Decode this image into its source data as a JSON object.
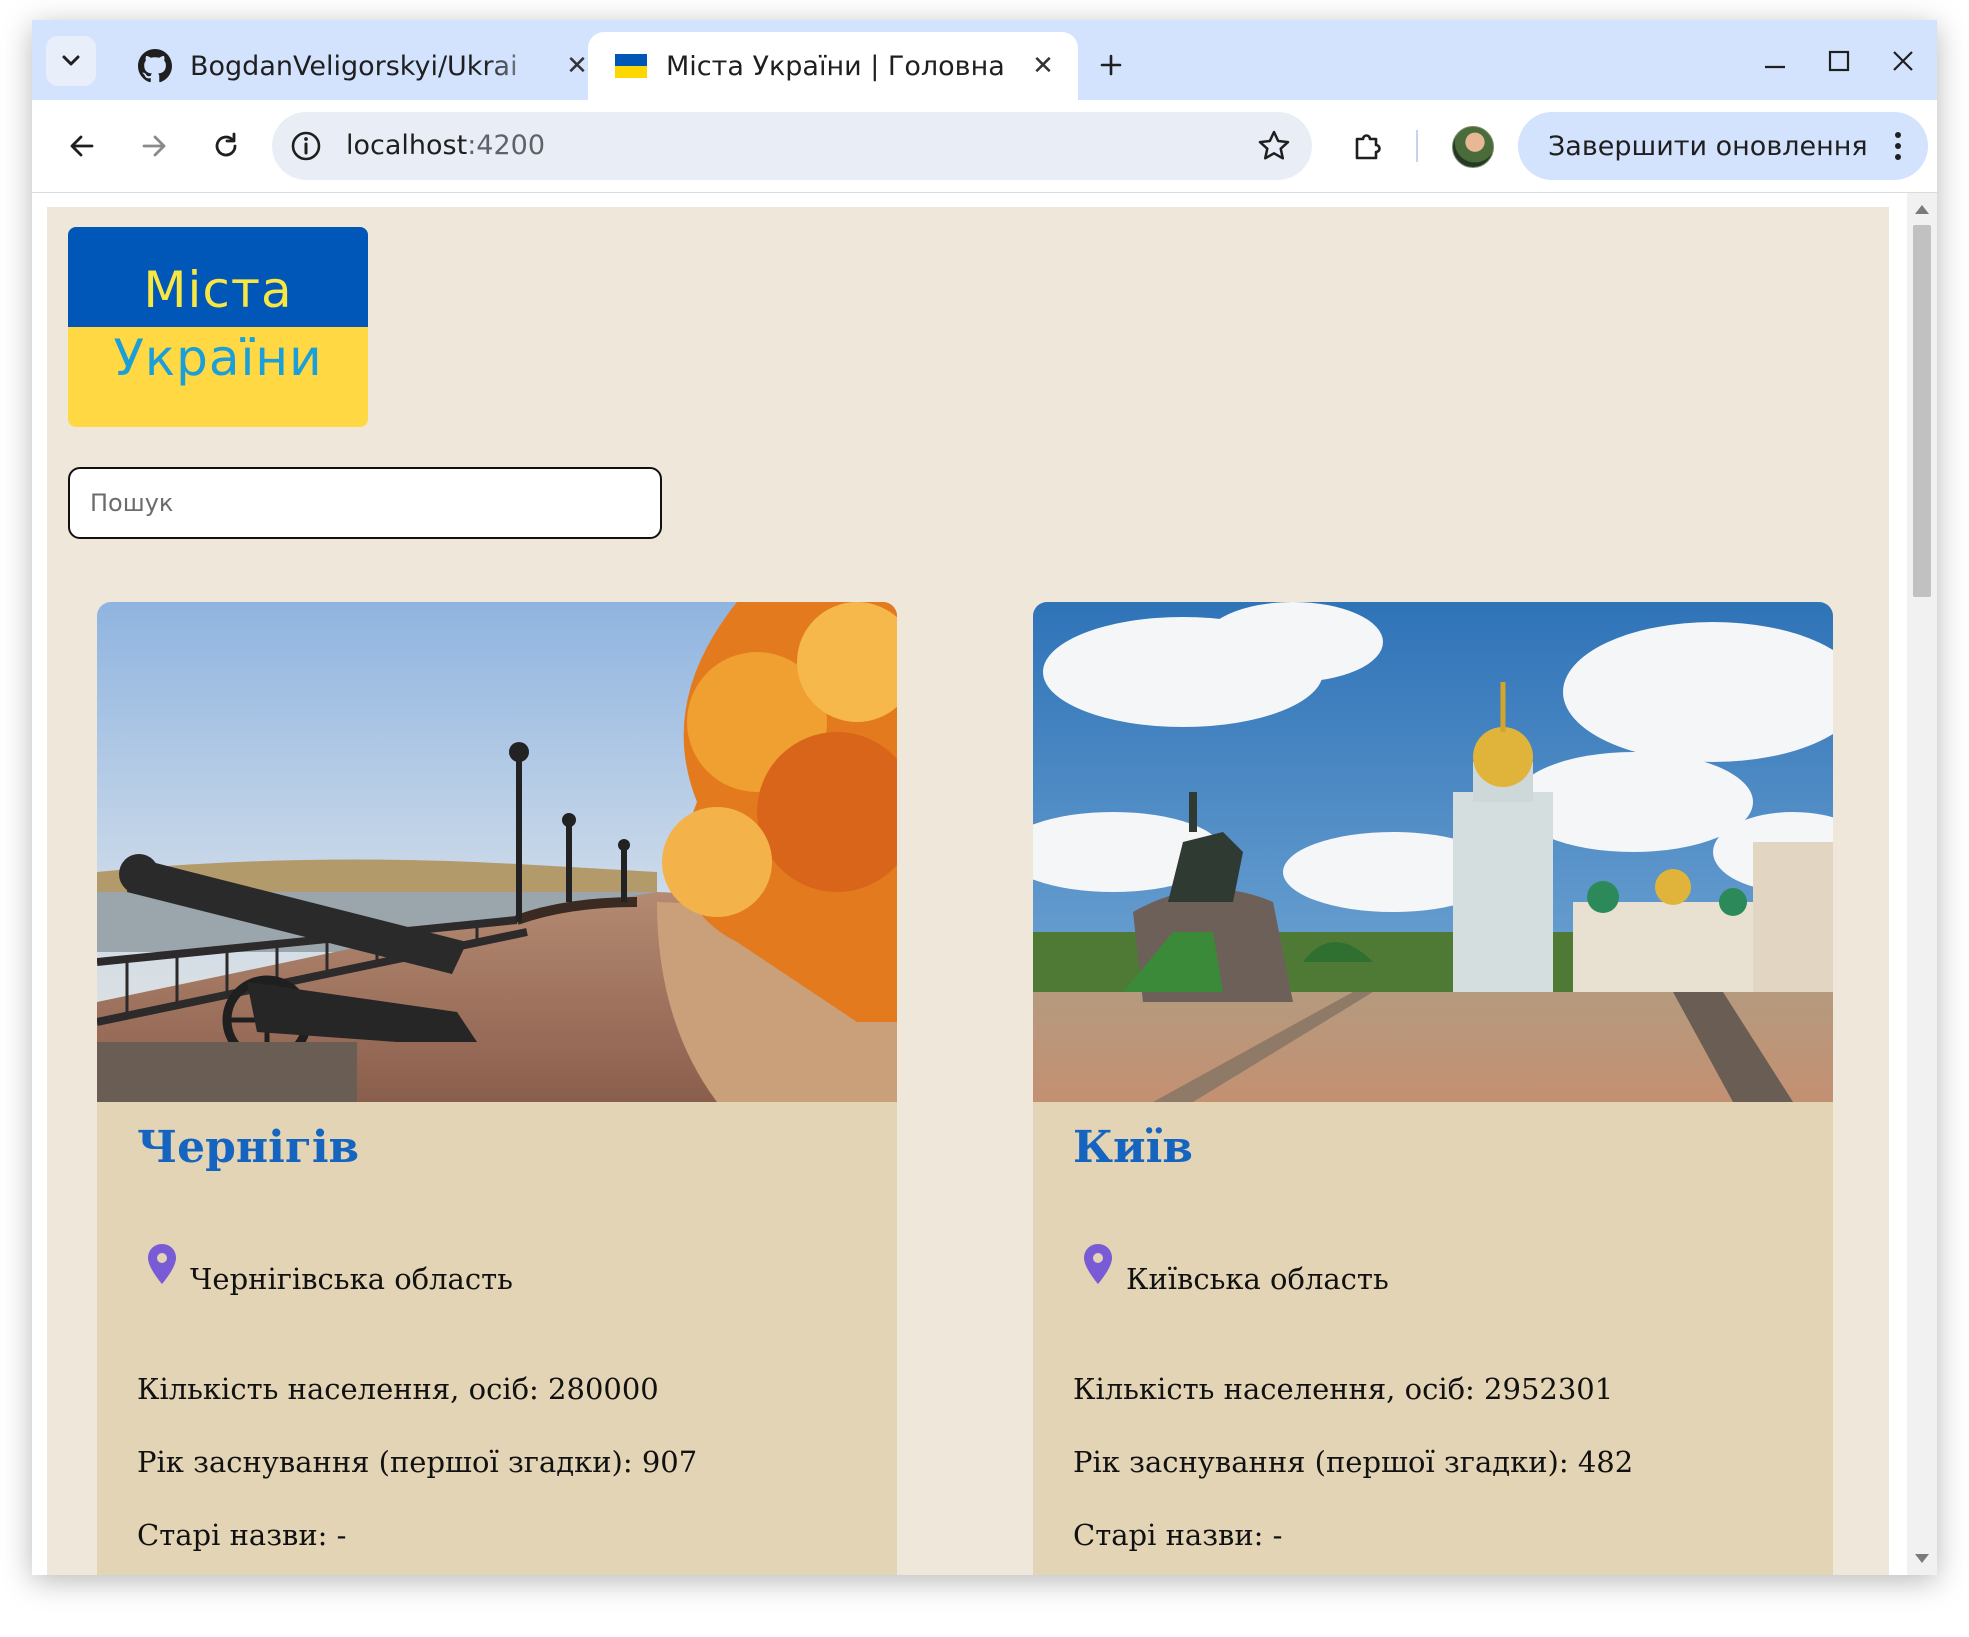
{
  "browser": {
    "tabs": [
      {
        "title": "BogdanVeligorskyi/Ukrai",
        "favicon": "github-icon",
        "active": false
      },
      {
        "title": "Міста України | Головна",
        "favicon": "ukraine-flag-icon",
        "active": true
      }
    ],
    "address": {
      "host": "localhost",
      "port": ":4200"
    },
    "update_button": "Завершити оновлення"
  },
  "logo": {
    "line1": "Міста",
    "line2": "України"
  },
  "search": {
    "placeholder": "Пошук"
  },
  "cities": [
    {
      "name": "Чернігів",
      "region": "Чернігівська область",
      "population": "Кількість населення, осіб: 280000",
      "founded": "Рік заснування (першої згадки): 907",
      "old_names": "Старі назви: -"
    },
    {
      "name": "Київ",
      "region": "Київська область",
      "population": "Кількість населення, осіб: 2952301",
      "founded": "Рік заснування (першої згадки): 482",
      "old_names": "Старі назви: -"
    }
  ],
  "colors": {
    "page_bg": "#efe7d9",
    "card_bg": "#e3d4b6",
    "city_link": "#1565c0",
    "flag_blue": "#0057b7",
    "flag_yellow": "#ffd843",
    "pin": "#7a5bd6"
  }
}
